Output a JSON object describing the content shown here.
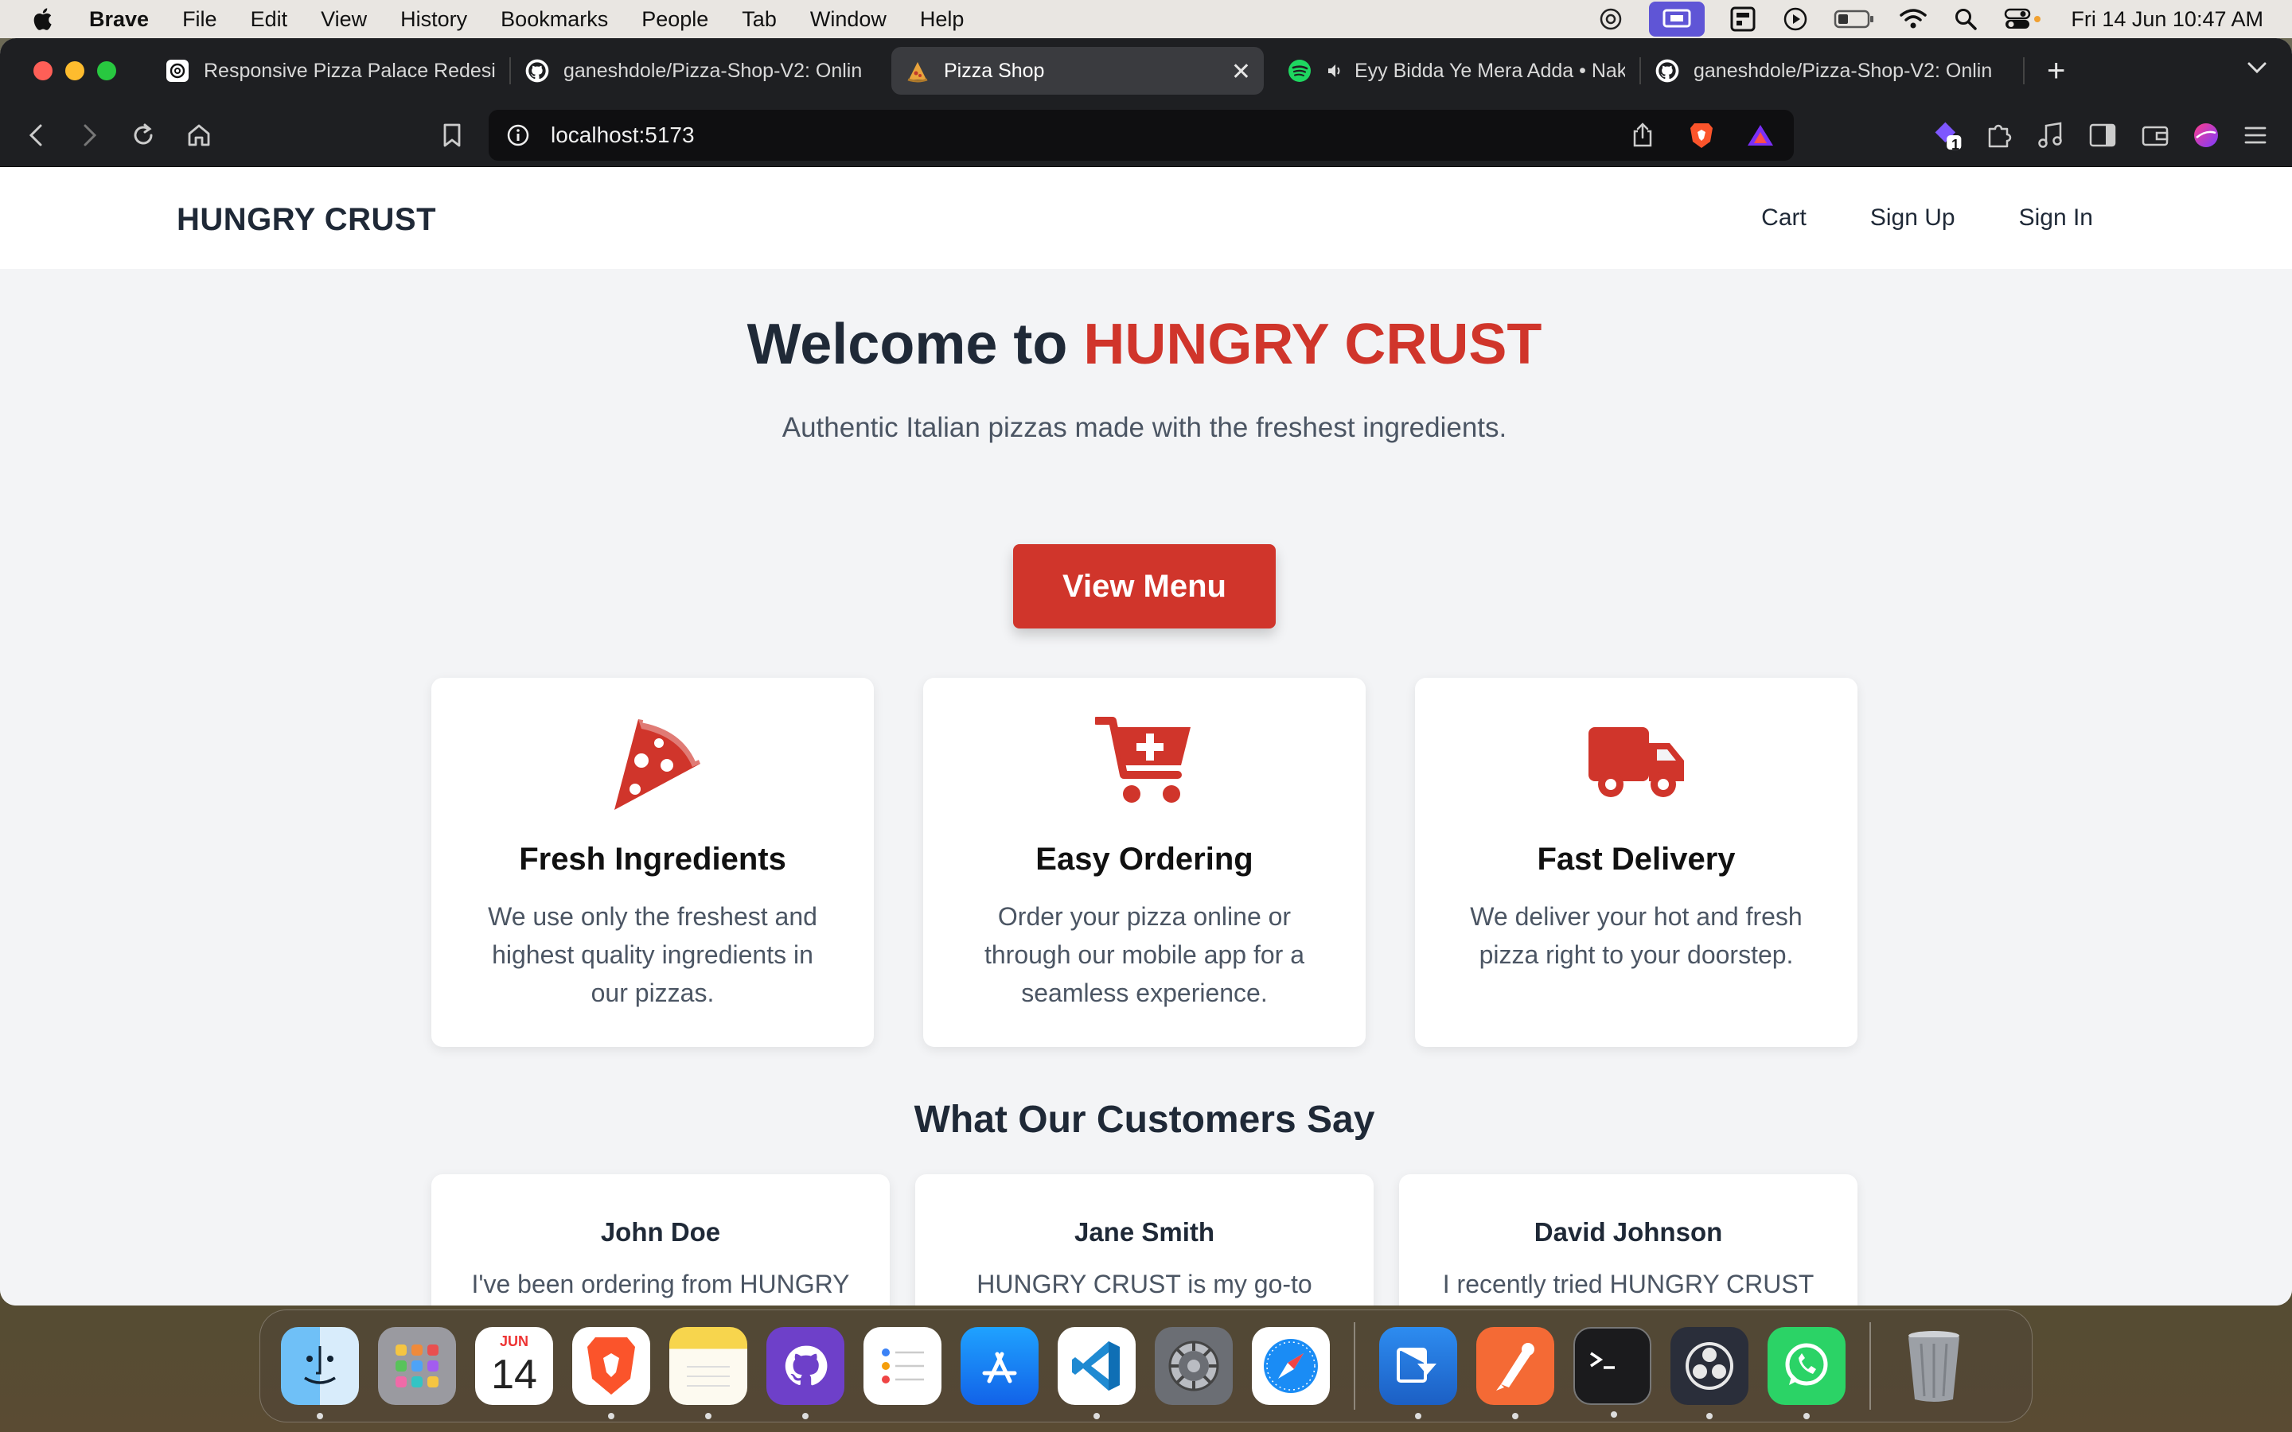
{
  "menubar": {
    "app_name": "Brave",
    "items": [
      "File",
      "Edit",
      "View",
      "History",
      "Bookmarks",
      "People",
      "Tab",
      "Window",
      "Help"
    ],
    "clock": "Fri 14 Jun  10:47 AM"
  },
  "browser": {
    "tabs": [
      {
        "title": "Responsive Pizza Palace Redesign",
        "icon": "openai-icon"
      },
      {
        "title": "ganeshdole/Pizza-Shop-V2: Onlin",
        "icon": "github-icon"
      },
      {
        "title": "Pizza Shop",
        "icon": "pizza-icon",
        "active": true
      },
      {
        "title": "Eyy Bidda Ye Mera Adda • Nak",
        "icon": "spotify-icon"
      },
      {
        "title": "ganeshdole/Pizza-Shop-V2: Onlin",
        "icon": "github-icon"
      }
    ],
    "new_tab": "+",
    "tab_close": "✕",
    "url": "localhost:5173",
    "extension_badge": "1"
  },
  "site": {
    "brand": "HUNGRY CRUST",
    "nav": [
      "Cart",
      "Sign Up",
      "Sign In"
    ],
    "hero": {
      "title_prefix": "Welcome to ",
      "title_accent": "HUNGRY CRUST",
      "subtitle": "Authentic Italian pizzas made with the freshest ingredients.",
      "cta": "View Menu"
    },
    "features": [
      {
        "icon": "pizza-slice-icon",
        "title": "Fresh Ingredients",
        "text": "We use only the freshest and highest quality ingredients in our pizzas."
      },
      {
        "icon": "cart-plus-icon",
        "title": "Easy Ordering",
        "text": "Order your pizza online or through our mobile app for a seamless experience."
      },
      {
        "icon": "truck-icon",
        "title": "Fast Delivery",
        "text": "We deliver your hot and fresh pizza right to your doorstep."
      }
    ],
    "testimonials_title": "What Our Customers Say",
    "testimonials": [
      {
        "name": "John Doe",
        "text": "I've been ordering from HUNGRY CRUST for years, and their"
      },
      {
        "name": "Jane Smith",
        "text": "HUNGRY CRUST is my go-to place for authentic Italian pizzas."
      },
      {
        "name": "David Johnson",
        "text": "I recently tried HUNGRY CRUST for the first time, and I was blown"
      }
    ]
  },
  "dock": {
    "calendar_month": "JUN",
    "calendar_day": "14"
  },
  "colors": {
    "accent": "#d0352b",
    "text_dark": "#1f2937",
    "text_muted": "#4b5563",
    "page_bg": "#f3f4f6"
  }
}
